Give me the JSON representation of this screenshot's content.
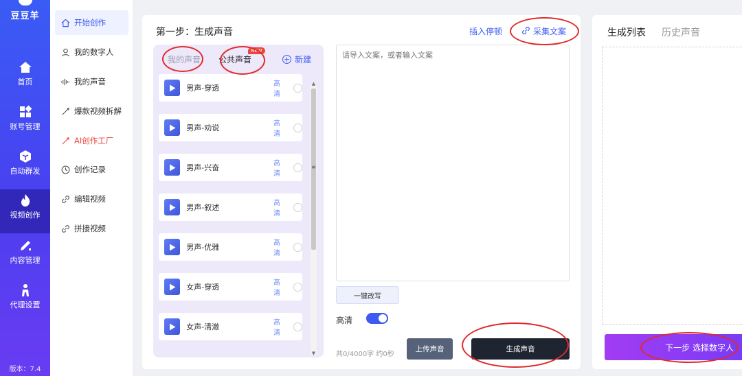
{
  "brand": {
    "name": "豆豆羊"
  },
  "rail": {
    "items": [
      {
        "label": "首页",
        "icon": "home-icon"
      },
      {
        "label": "账号管理",
        "icon": "grid-icon"
      },
      {
        "label": "自动群发",
        "icon": "cube-icon"
      },
      {
        "label": "视频创作",
        "icon": "flame-icon"
      },
      {
        "label": "内容管理",
        "icon": "edit-icon"
      },
      {
        "label": "代理设置",
        "icon": "person-icon"
      }
    ],
    "active": "视频创作",
    "version": "版本：7.4"
  },
  "subnav": {
    "items": [
      {
        "label": "开始创作",
        "icon": "home-outline-icon"
      },
      {
        "label": "我的数字人",
        "icon": "user-icon"
      },
      {
        "label": "我的声音",
        "icon": "waveform-icon"
      },
      {
        "label": "爆款视频拆解",
        "icon": "wand-icon"
      },
      {
        "label": "AI创作工厂",
        "icon": "wand-icon"
      },
      {
        "label": "创作记录",
        "icon": "clock-icon"
      },
      {
        "label": "编辑视频",
        "icon": "link-icon"
      },
      {
        "label": "拼接视频",
        "icon": "link-icon"
      }
    ],
    "active": "开始创作"
  },
  "main": {
    "step_title": "第一步：生成声音",
    "insert_pause": "插入停顿",
    "collect_copy": "采集文案",
    "voice_panel": {
      "tab_mine": "我的声音",
      "tab_public": "公共声音",
      "new_badge": "NEW",
      "new_button": "新建",
      "voices": [
        {
          "name": "男声-穿透",
          "quality": "高清"
        },
        {
          "name": "男声-劝说",
          "quality": "高清"
        },
        {
          "name": "男声-兴奋",
          "quality": "高清"
        },
        {
          "name": "男声-叙述",
          "quality": "高清"
        },
        {
          "name": "男声-优雅",
          "quality": "高清"
        },
        {
          "name": "女声-穿透",
          "quality": "高清"
        },
        {
          "name": "女声-清澈",
          "quality": "高清"
        }
      ]
    },
    "textarea_placeholder": "请导入文案，或者输入文案",
    "rewrite_button": "一键改写",
    "hq_label": "高清",
    "hq_enabled": true,
    "char_count": "共0/4000字 约0秒",
    "upload_button": "上传声音",
    "generate_button": "生成声音"
  },
  "right": {
    "tab_active": "生成列表",
    "tab_inactive": "历史声音",
    "next_button": "下一步 选择数字人"
  },
  "colors": {
    "accent": "#3d5af1",
    "annotation": "#e02a2a",
    "rail_gradient_top": "#3a5cf5",
    "rail_gradient_bottom": "#6a3cf2"
  }
}
